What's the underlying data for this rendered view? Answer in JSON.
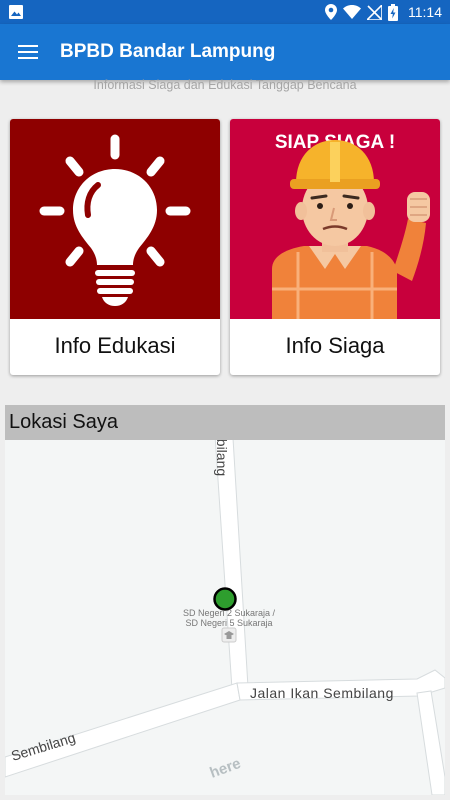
{
  "status_bar": {
    "time": "11:14",
    "icons": [
      "image-icon",
      "location-icon",
      "wifi-icon",
      "no-signal-icon",
      "battery-charging-icon"
    ]
  },
  "app_bar": {
    "title": "BPBD Bandar Lampung",
    "menu_icon": "hamburger-menu-icon"
  },
  "subtitle": "Informasi Siaga dan Edukasi Tanggap Bencana",
  "cards": {
    "edukasi": {
      "label": "Info Edukasi",
      "icon": "lightbulb-icon",
      "bg_color": "#8e0000"
    },
    "siaga": {
      "label": "Info Siaga",
      "banner": "SIAP SIAGA !",
      "icon": "worker-icon",
      "bg_color": "#c8003c"
    }
  },
  "map": {
    "title": "Lokasi Saya",
    "roads": {
      "vertical": "Sembilang",
      "horizontal": "Jalan  Ikan  Sembilang",
      "lower_left": "Sembilang"
    },
    "poi_line1": "SD Negeri 2 Sukaraja /",
    "poi_line2": "SD Negeri 5 Sukaraja",
    "watermark": "here",
    "marker_color": "#2e9e2e"
  }
}
